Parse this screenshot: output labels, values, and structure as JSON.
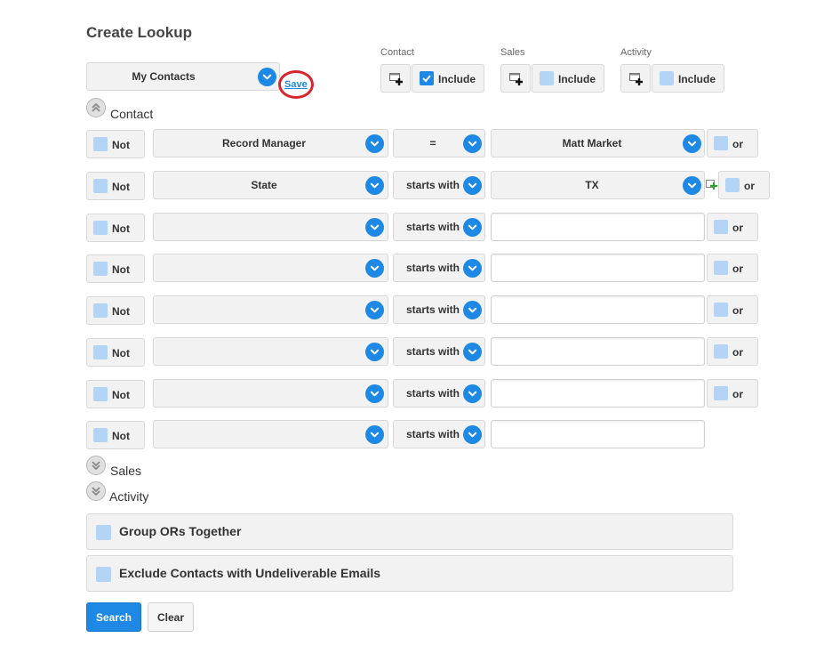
{
  "page": {
    "title": "Create Lookup",
    "save_label": "Save",
    "lookup_select": "My Contacts"
  },
  "includes": [
    {
      "heading": "Contact",
      "label": "Include",
      "checked": true
    },
    {
      "heading": "Sales",
      "label": "Include",
      "checked": false
    },
    {
      "heading": "Activity",
      "label": "Include",
      "checked": false
    }
  ],
  "sections": {
    "contact": "Contact",
    "sales": "Sales",
    "activity": "Activity"
  },
  "criteria": [
    {
      "not": "Not",
      "field": "Record Manager",
      "op": "=",
      "value": "Matt Market",
      "value_type": "select",
      "or": "or"
    },
    {
      "not": "Not",
      "field": "State",
      "op": "starts with",
      "value": "TX",
      "value_type": "select",
      "or": "or"
    },
    {
      "not": "Not",
      "field": "",
      "op": "starts with",
      "value": "",
      "value_type": "text",
      "or": "or"
    },
    {
      "not": "Not",
      "field": "",
      "op": "starts with",
      "value": "",
      "value_type": "text",
      "or": "or"
    },
    {
      "not": "Not",
      "field": "",
      "op": "starts with",
      "value": "",
      "value_type": "text",
      "or": "or"
    },
    {
      "not": "Not",
      "field": "",
      "op": "starts with",
      "value": "",
      "value_type": "text",
      "or": "or"
    },
    {
      "not": "Not",
      "field": "",
      "op": "starts with",
      "value": "",
      "value_type": "text",
      "or": "or"
    },
    {
      "not": "Not",
      "field": "",
      "op": "starts with",
      "value": "",
      "value_type": "text",
      "or": ""
    }
  ],
  "options": {
    "group_ors": "Group ORs Together",
    "exclude_undeliverable": "Exclude Contacts with Undeliverable Emails"
  },
  "buttons": {
    "search": "Search",
    "clear": "Clear"
  },
  "colors": {
    "accent": "#1e88e5",
    "checkbox_unchecked": "#b3d4f5",
    "highlight_ring": "#d9252b"
  }
}
